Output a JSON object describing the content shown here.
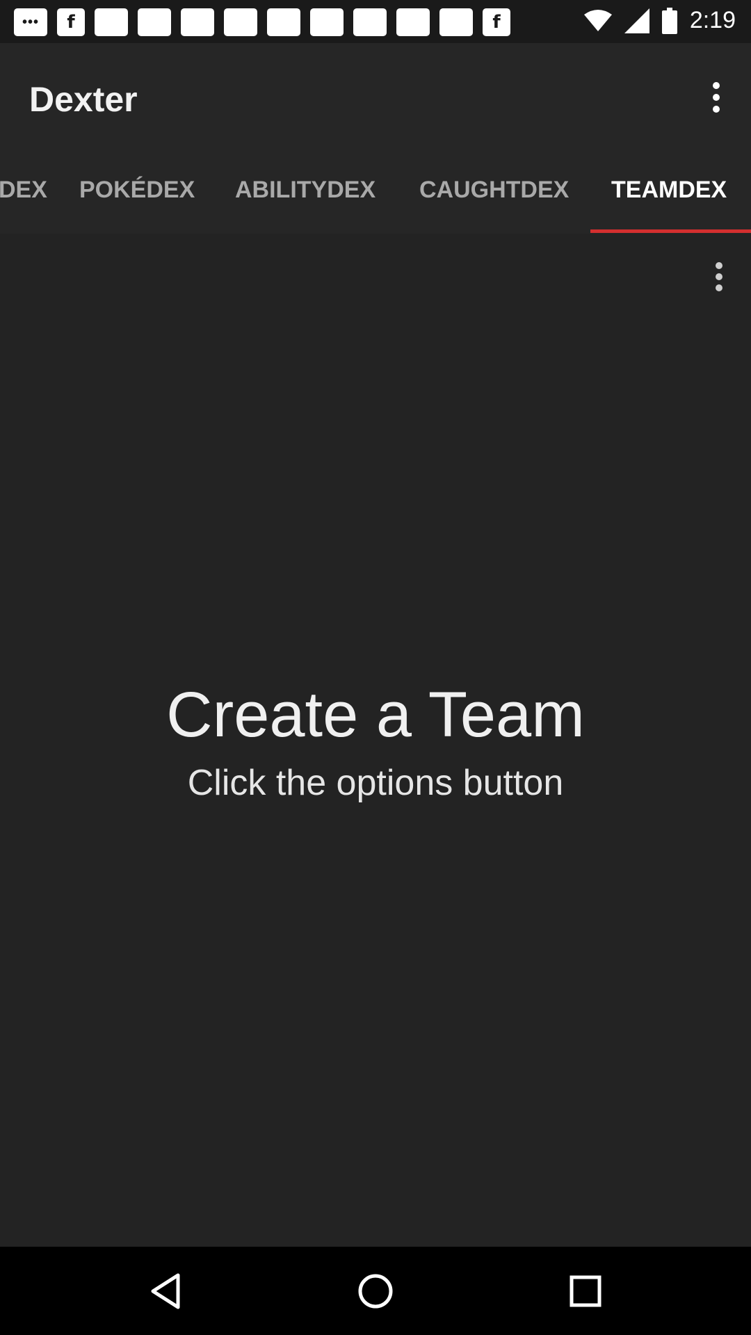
{
  "status_bar": {
    "notifications": [
      {
        "icon": "chat-dots-icon",
        "text": "•••"
      },
      {
        "icon": "facebook-icon",
        "text": "f"
      },
      {
        "icon": "blank-notification-icon",
        "text": ""
      },
      {
        "icon": "blank-notification-icon",
        "text": ""
      },
      {
        "icon": "blank-notification-icon",
        "text": ""
      },
      {
        "icon": "blank-notification-icon",
        "text": ""
      },
      {
        "icon": "blank-notification-icon",
        "text": ""
      },
      {
        "icon": "blank-notification-icon",
        "text": ""
      },
      {
        "icon": "blank-notification-icon",
        "text": ""
      },
      {
        "icon": "blank-notification-icon",
        "text": ""
      },
      {
        "icon": "blank-notification-icon",
        "text": ""
      },
      {
        "icon": "facebook-icon",
        "text": "f"
      }
    ],
    "time": "2:19",
    "icons": [
      "wifi-icon",
      "signal-icon",
      "battery-icon"
    ]
  },
  "app_bar": {
    "title": "Dexter",
    "overflow_icon": "more-vert-icon"
  },
  "tabs": [
    {
      "label": "DEX",
      "active": false
    },
    {
      "label": "POKÉDEX",
      "active": false
    },
    {
      "label": "ABILITYDEX",
      "active": false
    },
    {
      "label": "CAUGHTDEX",
      "active": false
    },
    {
      "label": "TEAMDEX",
      "active": true
    }
  ],
  "content": {
    "overflow_icon": "more-vert-icon",
    "empty_title": "Create a Team",
    "empty_subtitle": "Click the options button"
  },
  "nav_bar": {
    "buttons": [
      "back-icon",
      "home-icon",
      "recents-icon"
    ]
  },
  "colors": {
    "background": "#222222",
    "app_bar": "#262626",
    "accent": "#d32f2f",
    "nav_bar": "#000000"
  }
}
